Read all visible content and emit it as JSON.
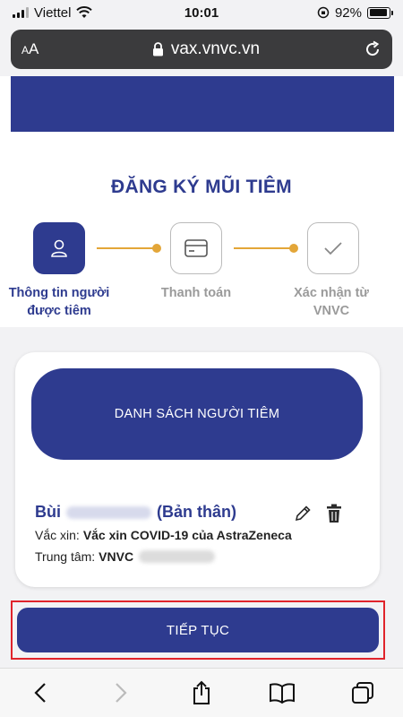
{
  "status_bar": {
    "carrier": "Viettel",
    "time": "10:01",
    "battery": "92%",
    "battery_level": 0.92
  },
  "browser": {
    "text_size_label_small": "A",
    "text_size_label_large": "A",
    "url": "vax.vnvc.vn"
  },
  "page": {
    "title": "ĐĂNG KÝ MŨI TIÊM",
    "steps": [
      {
        "label_line1": "Thông tin người",
        "label_line2": "được tiêm",
        "active": true
      },
      {
        "label_line1": "Thanh toán",
        "label_line2": "",
        "active": false
      },
      {
        "label_line1": "Xác nhận từ",
        "label_line2": "VNVC",
        "active": false
      }
    ],
    "list_header": "DANH SÁCH NGƯỜI TIÊM",
    "person": {
      "name_prefix": "Bùi",
      "relation": "(Bản thân)",
      "vaccine_label": "Vắc xin:",
      "vaccine_value": "Vắc xin COVID-19 của AstraZeneca",
      "center_label": "Trung tâm:",
      "center_value": "VNVC"
    },
    "continue_label": "TIẾP TỤC"
  },
  "colors": {
    "primary": "#2e3b8f",
    "accent": "#e3a638",
    "highlight": "#e0242b"
  }
}
